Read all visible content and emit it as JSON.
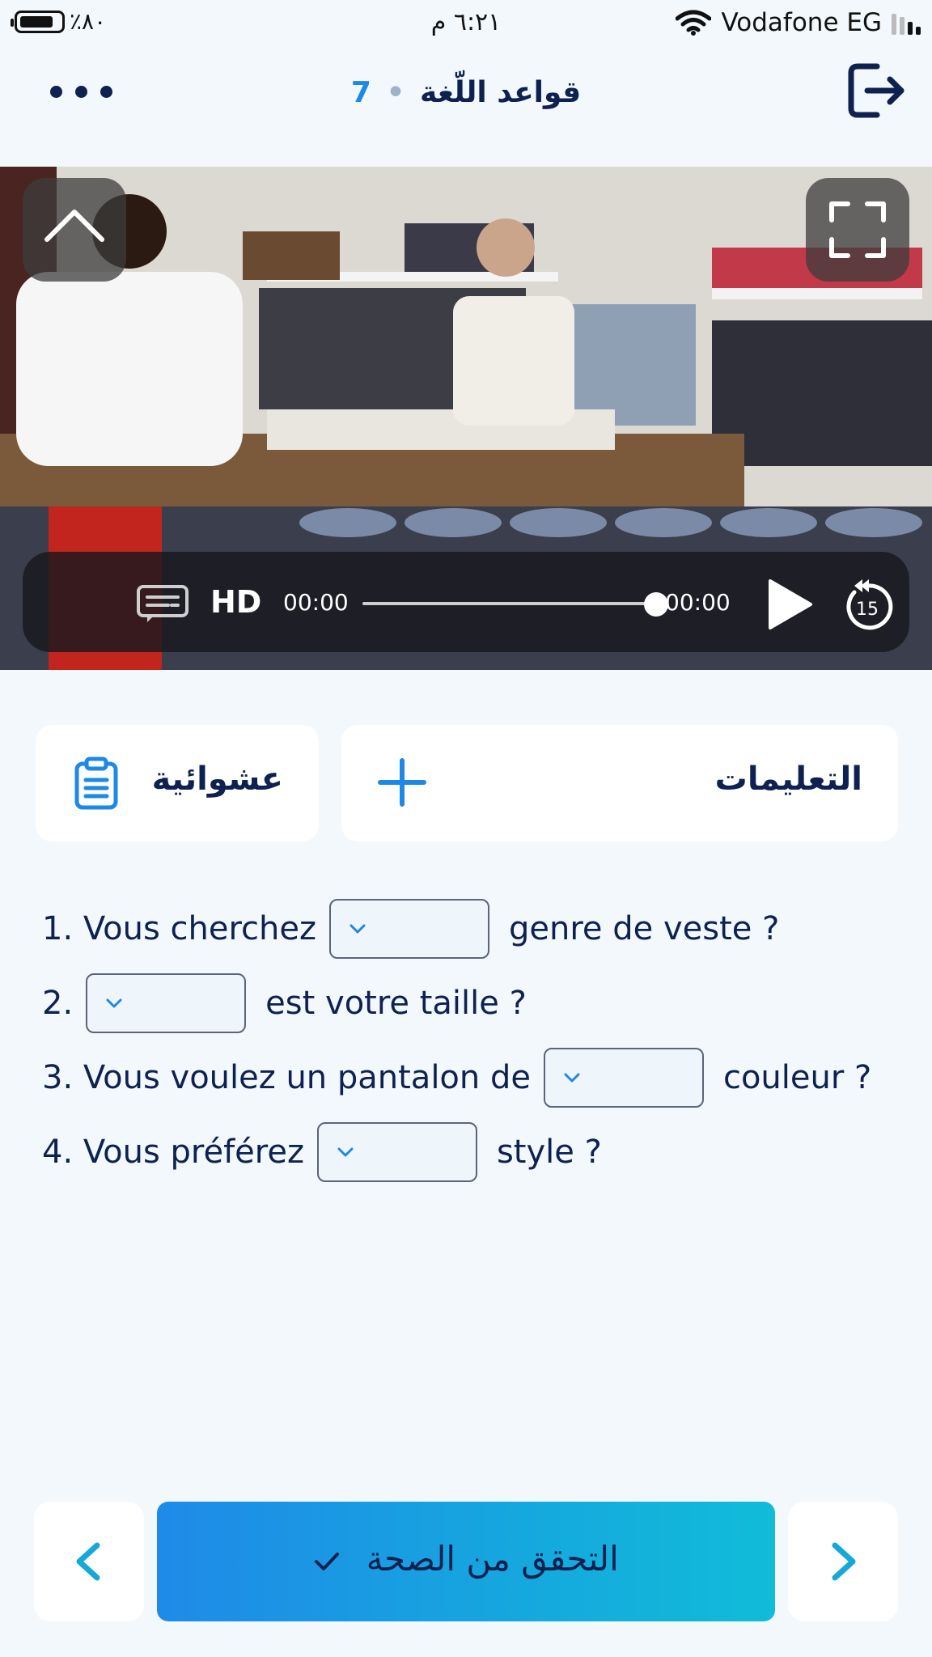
{
  "status_bar": {
    "battery_text": "٪٨٠",
    "time": "٦:٢١ م",
    "carrier": "Vodafone EG"
  },
  "header": {
    "lesson_number": "7",
    "title": "قواعد اللّغة"
  },
  "video": {
    "quality_label": "HD",
    "time_elapsed": "00:00",
    "time_remaining": "00:00",
    "progress": 1.0,
    "rewind_seconds": "15"
  },
  "actions": {
    "shuffle_label": "عشوائية",
    "instructions_label": "التعليمات"
  },
  "questions": [
    {
      "before": "1. Vous cherchez",
      "value": "",
      "after": "genre de veste ?"
    },
    {
      "before": "2.",
      "value": "",
      "after": "est votre taille ?"
    },
    {
      "before": "3. Vous voulez un pantalon de",
      "value": "",
      "after": "couleur ?"
    },
    {
      "before": "4. Vous préférez",
      "value": "",
      "after": "style ?"
    }
  ],
  "footer": {
    "check_label": "التحقق من الصحة"
  },
  "colors": {
    "accent": "#1e88e5",
    "text": "#0f2150",
    "background": "#f2f8fc"
  }
}
